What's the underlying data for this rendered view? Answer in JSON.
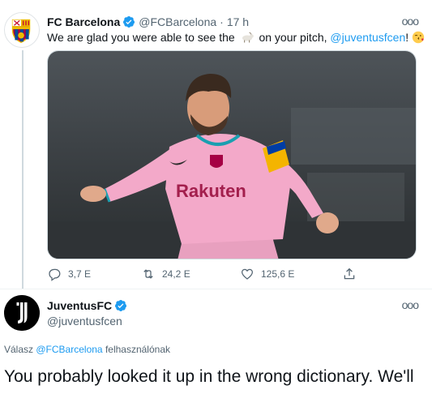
{
  "tweet1": {
    "author_name": "FC Barcelona",
    "author_handle": "@FCBarcelona",
    "separator": "·",
    "time": "17 h",
    "more": "ooo",
    "text_before": "We are glad you were able to see the",
    "text_after": "on your pitch,",
    "mention": "@juventusfcen",
    "text_end": "!",
    "emoji_goat": "goat-emoji",
    "emoji_kiss": "kissing-face-emoji",
    "media": {
      "shirt_text": "Rakuten",
      "shirt_color": "#f3a9c9"
    },
    "actions": {
      "replies": "3,7 E",
      "retweets": "24,2 E",
      "likes": "125,6 E"
    }
  },
  "tweet2": {
    "author_name": "JuventusFC",
    "author_handle": "@juventusfcen",
    "more": "ooo",
    "reply_prefix": "Válasz",
    "reply_mention": "@FCBarcelona",
    "reply_suffix": "felhasználónak",
    "text": "You probably looked it up in the wrong dictionary. We'll"
  },
  "colors": {
    "link": "#1d9bf0",
    "verified": "#1d9bf0",
    "secondary_text": "#536471"
  }
}
